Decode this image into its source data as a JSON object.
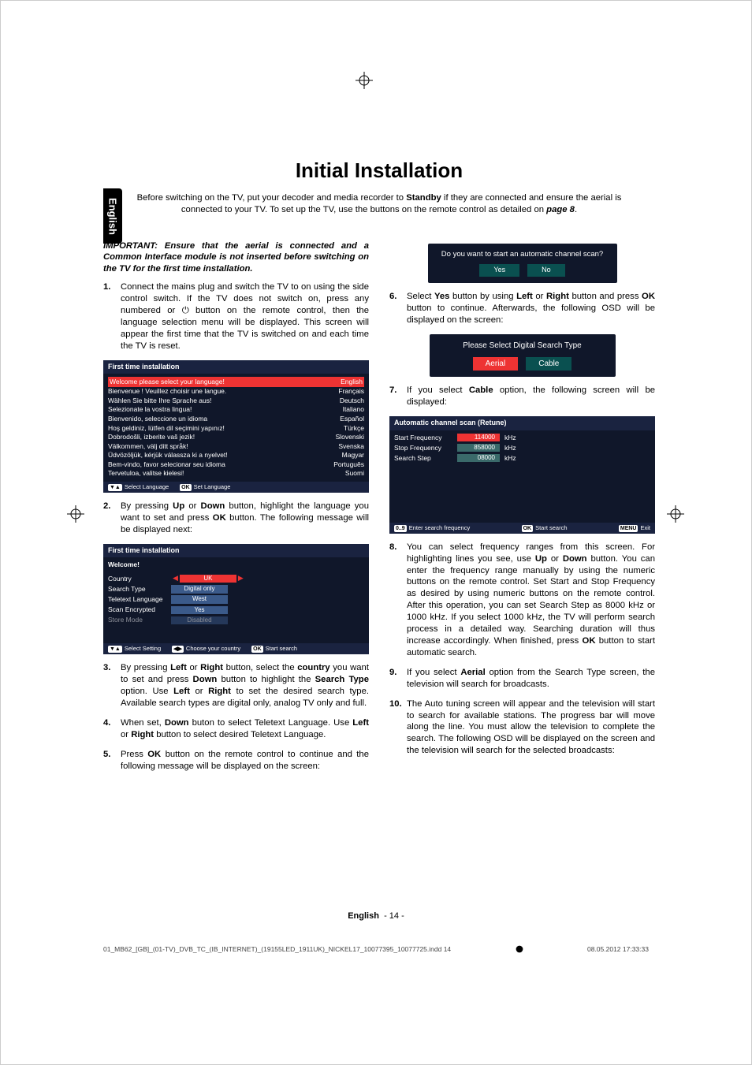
{
  "lang_tab": "English",
  "reg_marks": true,
  "title": "Initial Installation",
  "intro_parts": [
    "Before switching on the TV, put your decoder and media recorder to ",
    "Standby",
    " if they are connected and ensure the aerial is connected to your TV. To set up the TV, use the buttons on the remote control as detailed on ",
    "page 8",
    "."
  ],
  "important": "IMPORTANT: Ensure that the aerial is connected and a Common Interface module is not inserted before switching on the TV for the first time installation.",
  "steps_left": [
    {
      "n": "1.",
      "t": "Connect the mains plug and switch the TV to on using the side control switch. If the TV does not switch on, press any numbered or ⏻ button on the remote control, then the language selection menu will be displayed. This screen will appear the first time that the TV is switched on and each time the TV is reset."
    },
    {
      "osd": "lang"
    },
    {
      "n": "2.",
      "parts": [
        "By pressing ",
        "Up",
        " or ",
        "Down",
        " button, highlight the language you want to set and press ",
        "OK",
        " button. The following message will be displayed next:"
      ]
    },
    {
      "osd": "welcome"
    },
    {
      "n": "3.",
      "parts": [
        "By pressing ",
        "Left",
        " or ",
        "Right",
        " button, select the ",
        "country",
        " you want to set and press ",
        "Down",
        " button to highlight the ",
        "Search Type",
        " option. Use ",
        "Left",
        " or ",
        "Right",
        " to set the desired search type. Available search types are digital only, analog TV only and full."
      ]
    },
    {
      "n": "4.",
      "parts": [
        "When set, ",
        "Down",
        " buton to select Teletext Language. Use ",
        "Left",
        " or ",
        "Right",
        " button to select desired Teletext Language."
      ]
    },
    {
      "n": "5.",
      "parts": [
        "Press ",
        "OK",
        " button on the remote control to continue and the following message will be displayed on the screen:"
      ]
    }
  ],
  "steps_right": [
    {
      "osd": "scan"
    },
    {
      "n": "6.",
      "parts": [
        "Select ",
        "Yes",
        " button by using ",
        "Left",
        " or ",
        "Right",
        " button and press ",
        "OK",
        " button to continue. Afterwards, the following OSD will be displayed on the screen:"
      ]
    },
    {
      "osd": "searchtype"
    },
    {
      "n": "7.",
      "parts": [
        "If you select ",
        "Cable",
        " option, the following screen will be displayed:"
      ]
    },
    {
      "osd": "retune"
    },
    {
      "n": "8.",
      "parts": [
        "You can select frequency ranges from this screen. For highlighting lines you see, use ",
        "Up",
        " or ",
        "Down",
        " button. You can enter the frequency range manually by using the numeric buttons on the remote control. Set Start and Stop Frequency as desired by using numeric buttons on the remote control. After this operation, you can set Search Step as 8000 kHz or 1000 kHz. If you select 1000 kHz, the TV will perform search process in a detailed way. Searching duration will thus increase accordingly. When finished, press ",
        "OK",
        " button to start automatic search."
      ]
    },
    {
      "n": "9.",
      "parts": [
        "If you select ",
        "Aerial",
        " option from the Search Type screen, the television will search for broadcasts."
      ]
    },
    {
      "n": "10.",
      "t": "The Auto tuning screen will appear and the television will start to search for available stations. The progress bar will move along the line. You must allow the television to complete the search. The following OSD will be displayed on the screen and the television will search for the selected broadcasts:"
    }
  ],
  "osd_lang": {
    "title": "First time installation",
    "header": {
      "l": "Welcome please select your language!",
      "r": "English"
    },
    "rows": [
      {
        "l": "Bienvenue ! Veuillez choisir une langue.",
        "r": "Français"
      },
      {
        "l": "Wählen Sie bitte Ihre Sprache aus!",
        "r": "Deutsch"
      },
      {
        "l": "Selezionate la vostra lingua!",
        "r": "Italiano"
      },
      {
        "l": "Bienvenido, seleccione un idioma",
        "r": "Español"
      },
      {
        "l": "Hoş geldiniz, lütfen dil seçimini yapınız!",
        "r": "Türkçe"
      },
      {
        "l": "Dobrodošli, izberite vaš jezik!",
        "r": "Slovenski"
      },
      {
        "l": "Välkommen, välj ditt språk!",
        "r": "Svenska"
      },
      {
        "l": "Üdvözöljük, kérjük válassza ki a nyelvet!",
        "r": "Magyar"
      },
      {
        "l": "Bem-vindo, favor selecionar seu idioma",
        "r": "Português"
      },
      {
        "l": "Tervetuloa, valitse kielesi!",
        "r": "Suomi"
      }
    ],
    "footer": [
      {
        "b": "▼▲",
        "t": "Select Language"
      },
      {
        "b": "OK",
        "t": "Set Language"
      }
    ]
  },
  "osd_welcome": {
    "title": "First time installation",
    "subtitle": "Welcome!",
    "rows": [
      {
        "k": "Country",
        "v": "UK",
        "sel": true,
        "arrows": true
      },
      {
        "k": "Search Type",
        "v": "Digital only"
      },
      {
        "k": "Teletext Language",
        "v": "West"
      },
      {
        "k": "Scan Encrypted",
        "v": "Yes"
      },
      {
        "k": "Store Mode",
        "v": "Disabled",
        "dim": true
      }
    ],
    "footer": [
      {
        "b": "▼▲",
        "t": "Select Setting"
      },
      {
        "b": "◀▶",
        "t": "Choose your country"
      },
      {
        "b": "OK",
        "t": "Start search"
      }
    ]
  },
  "osd_scan": {
    "text": "Do you want to start an automatic channel scan?",
    "buttons": [
      "Yes",
      "No"
    ]
  },
  "osd_searchtype": {
    "text": "Please Select Digital Search Type",
    "buttons": [
      {
        "label": "Aerial",
        "sel": true
      },
      {
        "label": "Cable"
      }
    ]
  },
  "osd_retune": {
    "title": "Automatic channel scan (Retune)",
    "rows": [
      {
        "k": "Start Frequency",
        "v": "114000",
        "u": "kHz",
        "sel": true
      },
      {
        "k": "Stop Frequency",
        "v": "858000",
        "u": "kHz"
      },
      {
        "k": "Search Step",
        "v": "08000",
        "u": "kHz"
      }
    ],
    "footer": [
      {
        "b": "0..9",
        "t": "Enter search frequency"
      },
      {
        "b": "OK",
        "t": "Start search"
      },
      {
        "b": "MENU",
        "t": "Exit"
      }
    ]
  },
  "page_footer": {
    "lang": "English",
    "sep": "-",
    "num": "14"
  },
  "print_mark": {
    "left": "01_MB62_[GB]_(01-TV)_DVB_TC_(IB_INTERNET)_(19155LED_1911UK)_NICKEL17_10077395_10077725.indd   14",
    "right": "08.05.2012   17:33:33"
  }
}
